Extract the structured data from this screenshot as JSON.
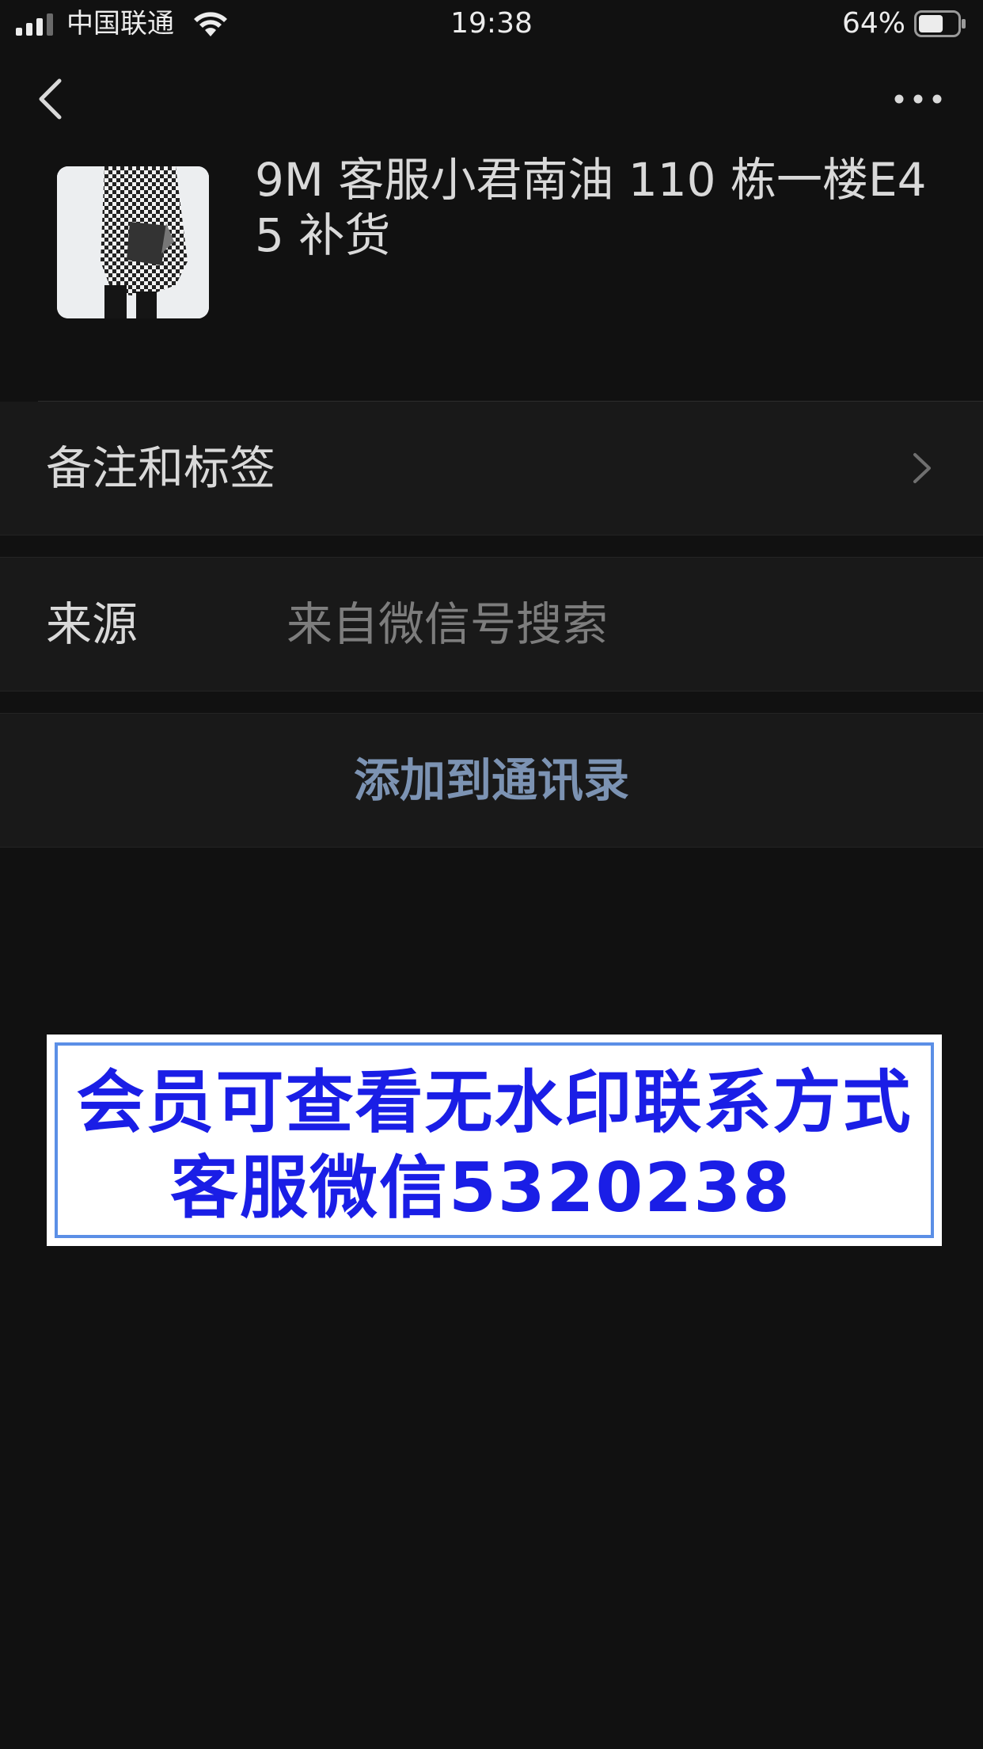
{
  "status_bar": {
    "carrier": "中国联通",
    "time": "19:38",
    "battery_percent": "64%",
    "battery_level": 0.64,
    "icons": [
      "signal-icon",
      "wifi-icon",
      "battery-icon"
    ]
  },
  "nav": {
    "back_icon": "chevron-left-icon",
    "more_icon": "more-dots-icon"
  },
  "profile": {
    "name": "9M 客服小君南油 110 栋一楼E45 补货"
  },
  "rows": {
    "remark_label": "备注和标签",
    "source_label": "来源",
    "source_value": "来自微信号搜索",
    "add_contact_label": "添加到通讯录"
  },
  "banner": {
    "line1": "会员可查看无水印联系方式",
    "line2": "客服微信5320238"
  },
  "colors": {
    "background": "#111111",
    "row_background": "#191919",
    "link_color": "#7c93b3",
    "banner_text": "#1a1ee6",
    "banner_border": "#5b8fe6"
  }
}
